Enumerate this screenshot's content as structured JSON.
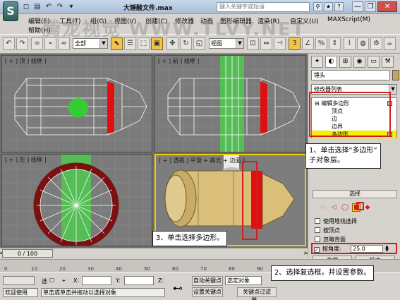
{
  "window": {
    "title": "大锤酸文件.max",
    "search_placeholder": "键入关键字或短语",
    "quick_access": [
      "◻",
      "▤",
      "↶",
      "↷",
      "▾"
    ],
    "title_icons": [
      "⚲",
      "★",
      "?"
    ],
    "controls": [
      "—",
      "❐",
      "✕"
    ]
  },
  "menu": {
    "row1": [
      "编辑(E)",
      "工具(T)",
      "组(G)",
      "视图(V)",
      "创建(C)",
      "修改器",
      "动画",
      "图形编辑器",
      "渲染(R)",
      "自定义(U)",
      "MAXScript(M)"
    ],
    "row2": [
      "帮助(H)"
    ]
  },
  "watermark": "腾龙视觉 WWW.TLVY.NET",
  "toolbar": {
    "selection_filter": "全部",
    "ref_coord": "视图",
    "snap_label": "3",
    "icons": [
      "undo-icon",
      "redo-icon",
      "link-icon",
      "unlink-icon",
      "bind-icon",
      "select-icon",
      "select-by-name-icon",
      "region-icon",
      "window-crossing-icon",
      "move-icon",
      "rotate-icon",
      "scale-icon",
      "pivot-icon",
      "mirror-icon",
      "align-icon",
      "snap-icon",
      "angle-snap-icon",
      "percent-snap-icon",
      "spinner-snap-icon",
      "named-selection-icon",
      "layer-icon",
      "curve-editor-icon",
      "schematic-icon",
      "material-icon",
      "render-setup-icon",
      "render-icon"
    ]
  },
  "viewports": {
    "top": "[ + ] 顶 ] 线框 ]",
    "front": "[ + ] 前 ] 线框 ]",
    "left": "[ + ] 左 ] 线框 ]",
    "perspective": "[ + ] 透视 ] 平滑 + 高光 + 边面 ]"
  },
  "panel": {
    "object_name": "锤头",
    "modifier_list": "修改器列表",
    "stack": [
      {
        "label": "⊟ 编辑多边形",
        "indent": 0,
        "selected": false
      },
      {
        "label": "顶点",
        "indent": 1,
        "selected": false
      },
      {
        "label": "边",
        "indent": 1,
        "selected": false
      },
      {
        "label": "边界",
        "indent": 1,
        "selected": false
      },
      {
        "label": "多边形",
        "indent": 1,
        "selected": true
      }
    ],
    "selection_rollout": "选择",
    "options": [
      {
        "label": "使用堆栈选择",
        "checked": false
      },
      {
        "label": "按顶点",
        "checked": false
      },
      {
        "label": "忽略背面",
        "checked": false
      }
    ],
    "by_angle": {
      "label": "按角度:",
      "value": "25.0",
      "checked": true
    },
    "shrink": "收缩",
    "grow": "扩大",
    "tabs": [
      "✦",
      "◐",
      "⊞",
      "◉",
      "▭",
      "⚒"
    ]
  },
  "timeline": {
    "frame": "0 / 100",
    "ticks": [
      "0",
      "10",
      "20",
      "30",
      "40",
      "50",
      "60",
      "70",
      "80",
      "90",
      "100"
    ]
  },
  "status": {
    "welcome": "欢迎使用",
    "prompt": "单击或单击并拖动以选择对象",
    "selected_label": "选",
    "x_label": "X:",
    "y_label": "Y:",
    "z_label": "Z:",
    "auto_key": "自动关键点",
    "set_key": "设置关键点",
    "selected_object": "选定对象",
    "key_filters": "关键点过滤器..."
  },
  "callouts": {
    "one": "1、单击选择“多边形”\n子对象层。",
    "two": "2、选择复选框，并设置参数。",
    "three": "3、单击选择多边形。"
  },
  "colors": {
    "accent_red": "#d41e1e",
    "selection_yellow": "#f4f000",
    "wireframe": "#ffffff",
    "poly_red": "#e01010",
    "poly_green": "#33cc33",
    "hammer_tan": "#d9bf7a"
  }
}
